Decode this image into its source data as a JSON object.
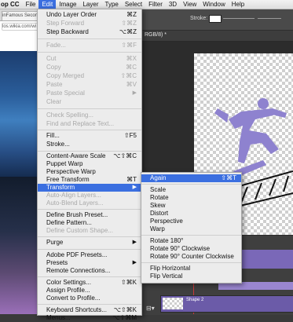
{
  "menubar": {
    "app_name": "op CC",
    "items": [
      {
        "label": "File"
      },
      {
        "label": "Edit"
      },
      {
        "label": "Image"
      },
      {
        "label": "Layer"
      },
      {
        "label": "Type"
      },
      {
        "label": "Select"
      },
      {
        "label": "Filter"
      },
      {
        "label": "3D"
      },
      {
        "label": "View"
      },
      {
        "label": "Window"
      },
      {
        "label": "Help"
      }
    ]
  },
  "browser": {
    "tab_title": "inFamous Secon",
    "url": "los.wikia.com/wi"
  },
  "photoshop": {
    "stroke_label": "Stroke:",
    "document_tab": "RGB/8) *",
    "timeline_clip_label": "Shape 2"
  },
  "edit_menu": {
    "undo": {
      "label": "Undo Layer Order",
      "shortcut": "⌘Z"
    },
    "step_forward": {
      "label": "Step Forward",
      "shortcut": "⇧⌘Z"
    },
    "step_backward": {
      "label": "Step Backward",
      "shortcut": "⌥⌘Z"
    },
    "fade": {
      "label": "Fade...",
      "shortcut": "⇧⌘F"
    },
    "cut": {
      "label": "Cut",
      "shortcut": "⌘X"
    },
    "copy": {
      "label": "Copy",
      "shortcut": "⌘C"
    },
    "copy_merged": {
      "label": "Copy Merged",
      "shortcut": "⇧⌘C"
    },
    "paste": {
      "label": "Paste",
      "shortcut": "⌘V"
    },
    "paste_special": {
      "label": "Paste Special"
    },
    "clear": {
      "label": "Clear"
    },
    "check_spelling": {
      "label": "Check Spelling..."
    },
    "find_replace": {
      "label": "Find and Replace Text..."
    },
    "fill": {
      "label": "Fill...",
      "shortcut": "⇧F5"
    },
    "stroke": {
      "label": "Stroke..."
    },
    "content_aware_scale": {
      "label": "Content-Aware Scale",
      "shortcut": "⌥⇧⌘C"
    },
    "puppet_warp": {
      "label": "Puppet Warp"
    },
    "perspective_warp": {
      "label": "Perspective Warp"
    },
    "free_transform": {
      "label": "Free Transform",
      "shortcut": "⌘T"
    },
    "transform": {
      "label": "Transform"
    },
    "auto_align": {
      "label": "Auto-Align Layers..."
    },
    "auto_blend": {
      "label": "Auto-Blend Layers..."
    },
    "define_brush": {
      "label": "Define Brush Preset..."
    },
    "define_pattern": {
      "label": "Define Pattern..."
    },
    "define_shape": {
      "label": "Define Custom Shape..."
    },
    "purge": {
      "label": "Purge"
    },
    "pdf_presets": {
      "label": "Adobe PDF Presets..."
    },
    "presets": {
      "label": "Presets"
    },
    "remote_connections": {
      "label": "Remote Connections..."
    },
    "color_settings": {
      "label": "Color Settings...",
      "shortcut": "⇧⌘K"
    },
    "assign_profile": {
      "label": "Assign Profile..."
    },
    "convert_profile": {
      "label": "Convert to Profile..."
    },
    "keyboard_shortcuts": {
      "label": "Keyboard Shortcuts...",
      "shortcut": "⌥⇧⌘K"
    },
    "menus": {
      "label": "Menus...",
      "shortcut": "⌥⇧⌘M"
    }
  },
  "transform_submenu": {
    "again": {
      "label": "Again",
      "shortcut": "⇧⌘T"
    },
    "scale": {
      "label": "Scale"
    },
    "rotate": {
      "label": "Rotate"
    },
    "skew": {
      "label": "Skew"
    },
    "distort": {
      "label": "Distort"
    },
    "perspective": {
      "label": "Perspective"
    },
    "warp": {
      "label": "Warp"
    },
    "rotate_180": {
      "label": "Rotate 180°"
    },
    "rotate_90_cw": {
      "label": "Rotate 90° Clockwise"
    },
    "rotate_90_ccw": {
      "label": "Rotate 90° Counter Clockwise"
    },
    "flip_h": {
      "label": "Flip Horizontal"
    },
    "flip_v": {
      "label": "Flip Vertical"
    }
  },
  "colors": {
    "highlight": "#3b6fe0",
    "menu_bg": "#ececec",
    "figure": "#8e82cf"
  }
}
